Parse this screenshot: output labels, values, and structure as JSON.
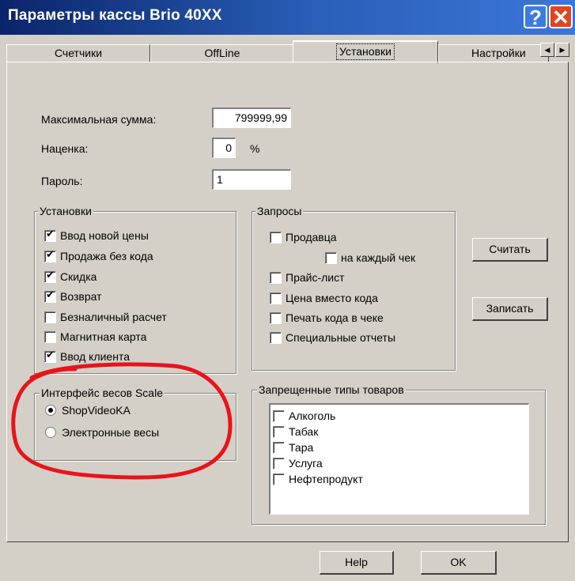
{
  "window": {
    "title": "Параметры кассы Brio 40XX"
  },
  "tabs": [
    {
      "label": "Счетчики"
    },
    {
      "label": "OffLine"
    },
    {
      "label": "Установки"
    },
    {
      "label": "Настройки"
    }
  ],
  "fields": {
    "max_sum": {
      "label": "Максимальная сумма:",
      "value": "799999,99"
    },
    "markup": {
      "label": "Наценка:",
      "value": "0",
      "unit": "%"
    },
    "password": {
      "label": "Пароль:",
      "value": "1"
    }
  },
  "settings_group": {
    "title": "Установки",
    "items": [
      {
        "label": "Ввод новой цены",
        "checked": true
      },
      {
        "label": "Продажа без кода",
        "checked": true
      },
      {
        "label": "Скидка",
        "checked": true
      },
      {
        "label": "Возврат",
        "checked": true
      },
      {
        "label": "Безналичный расчет",
        "checked": false
      },
      {
        "label": "Магнитная карта",
        "checked": false
      },
      {
        "label": "Ввод клиента",
        "checked": true
      }
    ]
  },
  "requests_group": {
    "title": "Запросы",
    "items": [
      {
        "label": "Продавца",
        "checked": false
      },
      {
        "label": "на каждый чек",
        "checked": false
      },
      {
        "label": "Прайс-лист",
        "checked": false
      },
      {
        "label": "Цена вместо кода",
        "checked": false
      },
      {
        "label": "Печать кода в чеке",
        "checked": false
      },
      {
        "label": "Специальные отчеты",
        "checked": false
      }
    ]
  },
  "scale_group": {
    "title": "Интерфейс весов Scale",
    "options": [
      {
        "label": "ShopVideoKA",
        "selected": true
      },
      {
        "label": "Электронные весы",
        "selected": false
      }
    ]
  },
  "forbidden_group": {
    "title": "Запрещенные типы товаров",
    "items": [
      {
        "label": "Алкоголь",
        "checked": false
      },
      {
        "label": "Табак",
        "checked": false
      },
      {
        "label": "Тара",
        "checked": false
      },
      {
        "label": "Услуга",
        "checked": false
      },
      {
        "label": "Нефтепродукт",
        "checked": false
      }
    ]
  },
  "buttons": {
    "read": "Считать",
    "write": "Записать",
    "help": "Help",
    "ok": "OK"
  },
  "colors": {
    "title_bar": "#0a246a",
    "dialog_bg": "#d4d0c8",
    "annotation": "#e8141b"
  }
}
